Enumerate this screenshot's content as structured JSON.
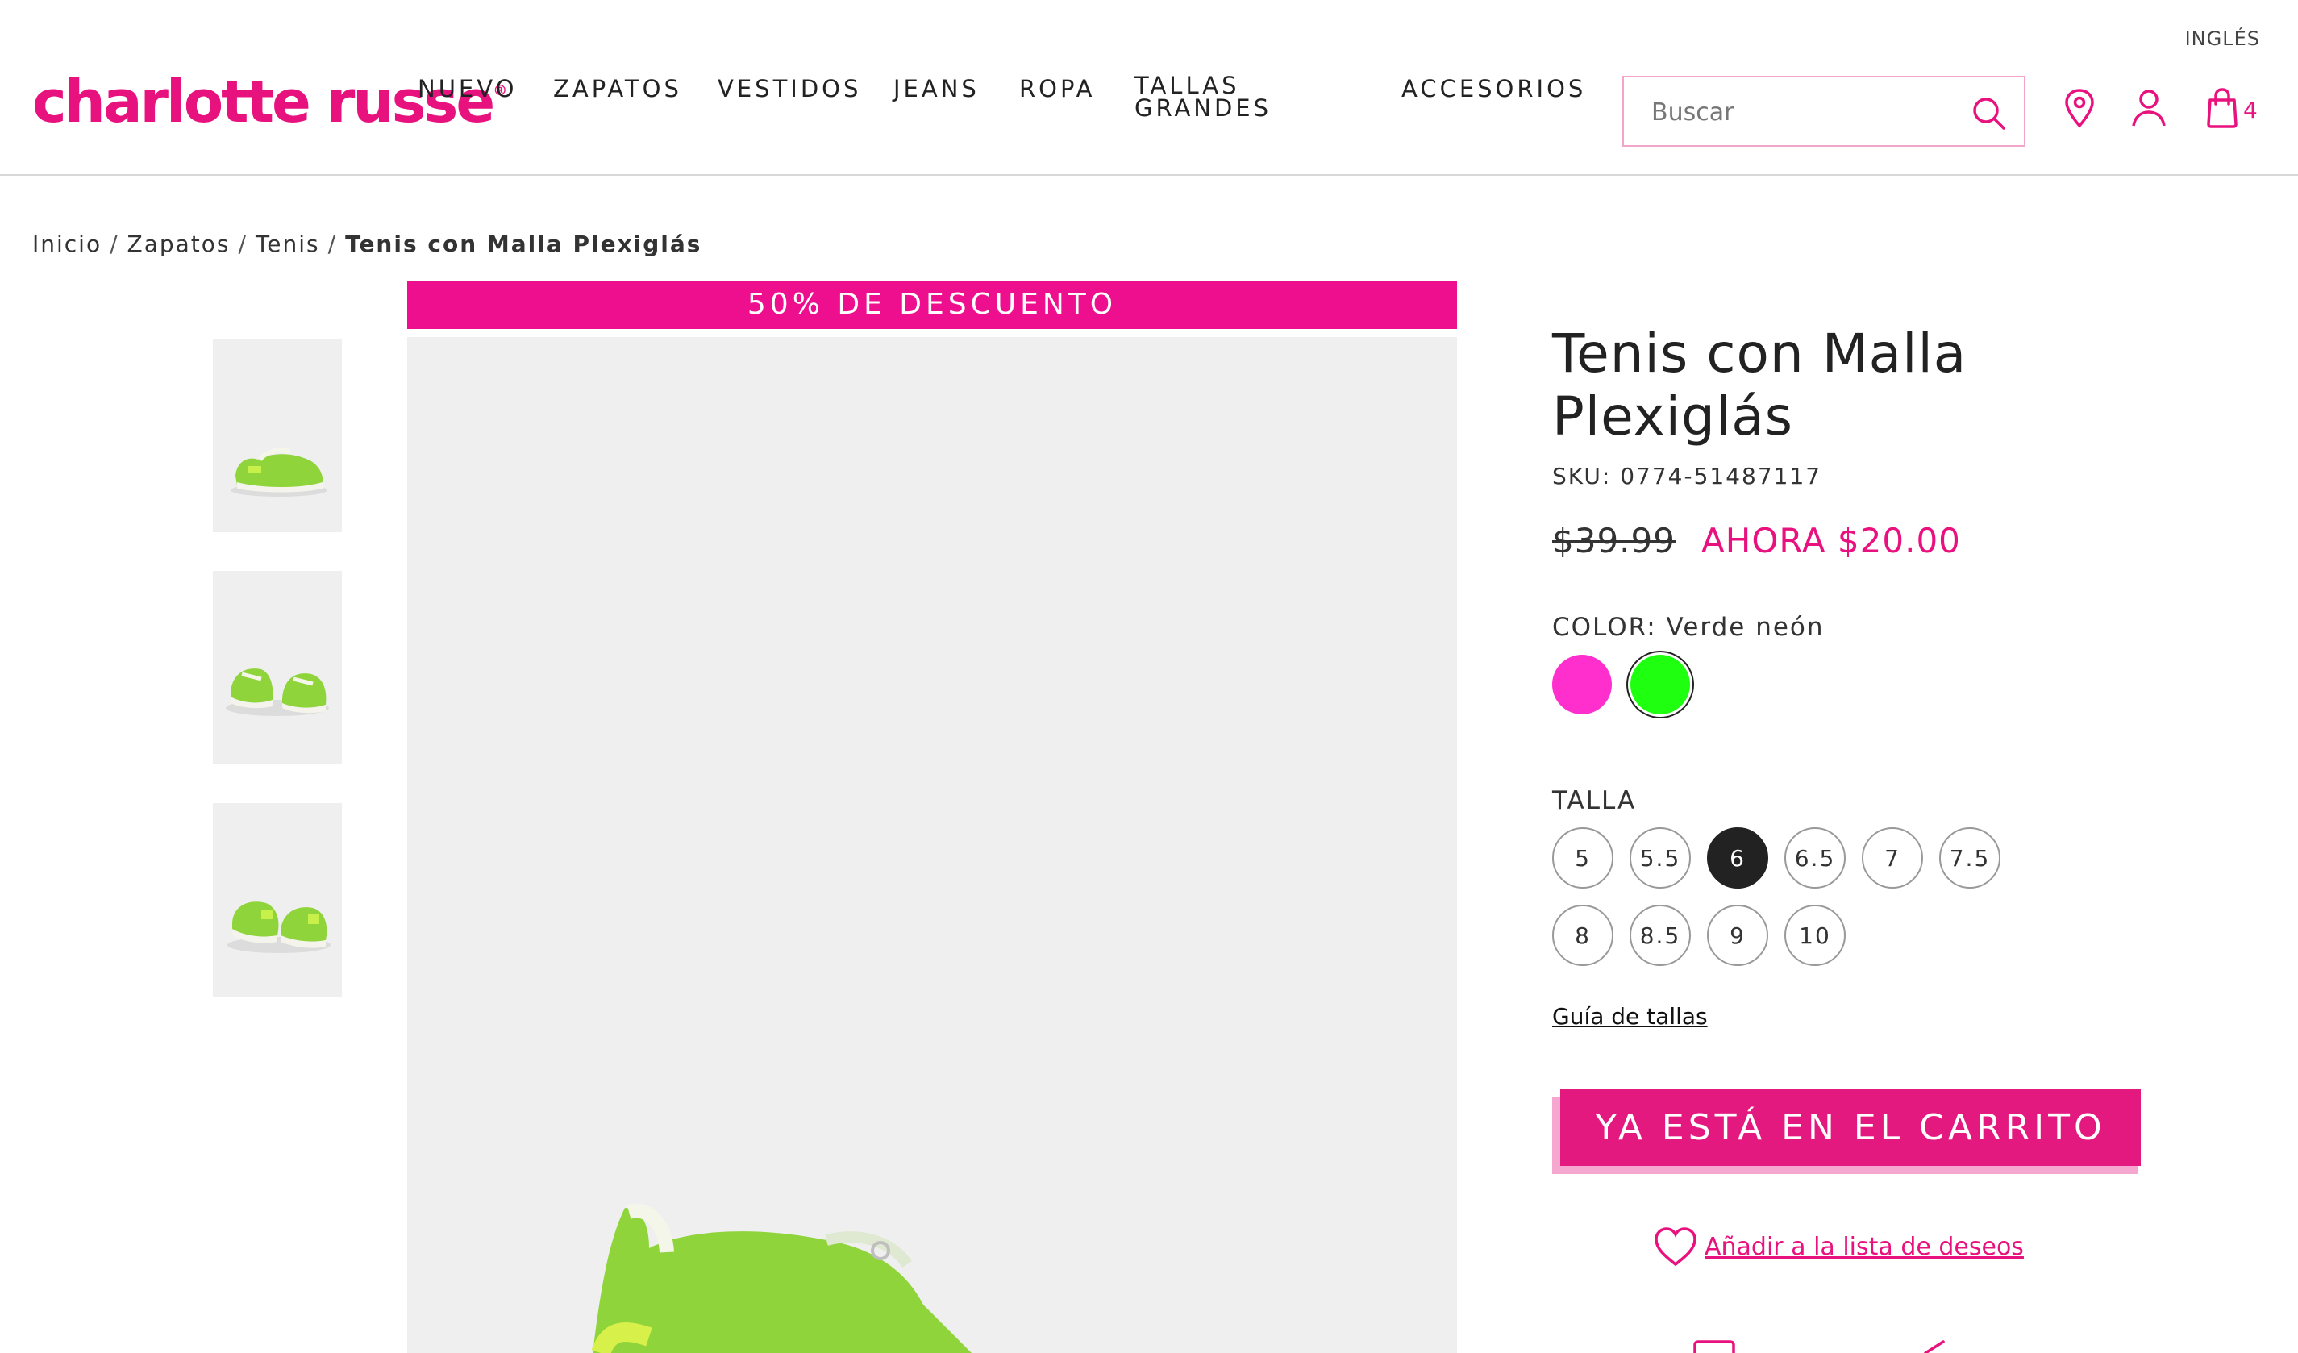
{
  "header": {
    "language": "INGLÉS",
    "logo_text": "charlotte russe",
    "logo_mark": "®",
    "nav": [
      {
        "label": "NUEVO"
      },
      {
        "label": "ZAPATOS"
      },
      {
        "label": "VESTIDOS"
      },
      {
        "label": "JEANS"
      },
      {
        "label": "ROPA"
      },
      {
        "label": "TALLAS GRANDES"
      },
      {
        "label": "ACCESORIOS"
      }
    ],
    "search_placeholder": "Buscar",
    "cart_count": "4",
    "icons": [
      "search-icon",
      "location-pin-icon",
      "user-icon",
      "shopping-bag-icon"
    ],
    "brand_color": "#e8127f"
  },
  "breadcrumb": [
    "Inicio",
    "Zapatos",
    "Tenis",
    "Tenis con Malla Plexiglás"
  ],
  "gallery": {
    "discount_banner": "50% DE DESCUENTO",
    "thumbnails": 3
  },
  "product": {
    "title": "Tenis con Malla Plexiglás",
    "sku_label": "SKU:",
    "sku": "0774-51487117",
    "price_old": "$39.99",
    "price_new": "AHORA $20.00",
    "color_label": "COLOR:",
    "color_value": "Verde neón",
    "colors": [
      {
        "name": "pink",
        "hex": "#ff2fce"
      },
      {
        "name": "green",
        "hex": "#1fff10",
        "selected": true
      }
    ],
    "size_label": "TALLA",
    "sizes": [
      "5",
      "5.5",
      "6",
      "6.5",
      "7",
      "7.5",
      "8",
      "8.5",
      "9",
      "10"
    ],
    "selected_size": "6",
    "size_guide": "Guía de tallas",
    "cart_button": "YA ESTÁ EN EL CARRITO",
    "wishlist": "Añadir a la lista de deseos"
  }
}
